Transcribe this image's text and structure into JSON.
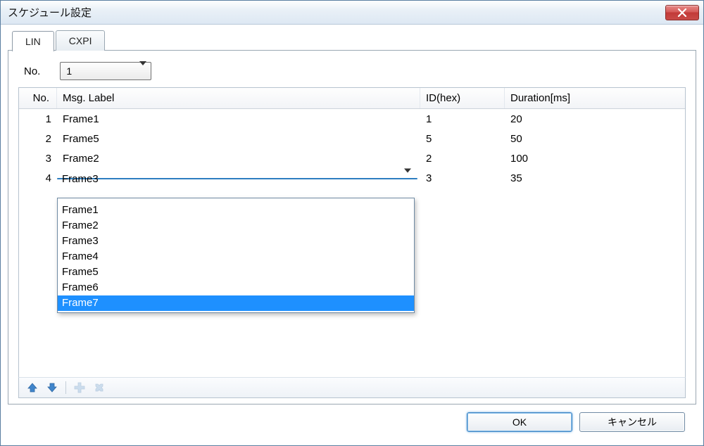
{
  "window": {
    "title": "スケジュール設定"
  },
  "tabs": {
    "lin": "LIN",
    "cxpi": "CXPI"
  },
  "no_selector": {
    "label": "No.",
    "value": "1"
  },
  "grid": {
    "headers": {
      "no": "No.",
      "msg": "Msg. Label",
      "id": "ID(hex)",
      "dur": "Duration[ms]"
    },
    "rows": [
      {
        "no": "1",
        "msg": "Frame1",
        "id": "1",
        "dur": "20"
      },
      {
        "no": "2",
        "msg": "Frame5",
        "id": "5",
        "dur": "50"
      },
      {
        "no": "3",
        "msg": "Frame2",
        "id": "2",
        "dur": "100"
      },
      {
        "no": "4",
        "msg": "Frame3",
        "id": "3",
        "dur": "35"
      }
    ]
  },
  "msg_dropdown": {
    "options": [
      "Frame1",
      "Frame2",
      "Frame3",
      "Frame4",
      "Frame5",
      "Frame6",
      "Frame7"
    ],
    "highlighted": "Frame7"
  },
  "buttons": {
    "ok": "OK",
    "cancel": "キャンセル"
  }
}
